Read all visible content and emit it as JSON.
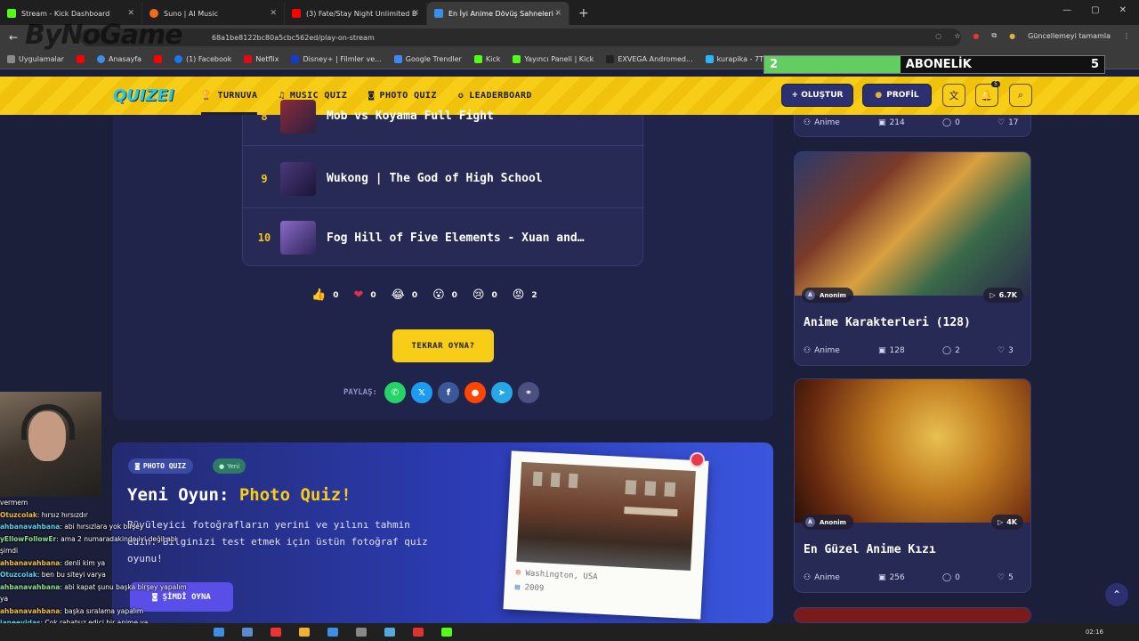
{
  "browser": {
    "tabs": [
      {
        "title": "Stream - Kick Dashboard",
        "color": "#53fc18"
      },
      {
        "title": "Suno | AI Music",
        "color": "#f26a1b"
      },
      {
        "title": "(3) Fate/Stay Night Unlimited B",
        "color": "#ff0000"
      },
      {
        "title": "En İyi Anime Dövüş Sahneleri -",
        "color": "#3c8ee7"
      }
    ],
    "url": "68a1be8122bc80a5cbc562ed/play-on-stream",
    "update_label": "Güncellemeyi tamamla",
    "bookmarks": [
      "Uygulamalar",
      "Anasayfa",
      "(1) Facebook",
      "Netflix",
      "Disney+ | Filmler ve...",
      "Google Trendler",
      "Kick",
      "Yayıncı Paneli | Kick",
      "EXVEGA Andromed...",
      "kurapika - 7TV",
      "Su"
    ],
    "other_bookmarks": "Tüm Yer İşaretleri"
  },
  "overlay": {
    "logo_text": "ByNoGame",
    "sub_current": "2",
    "sub_label": "ABONELİK",
    "sub_goal": "5",
    "sub_progress": 0.4
  },
  "site": {
    "brand": "QUIZEI",
    "nav": [
      "TURNUVA",
      "MUSIC QUIZ",
      "PHOTO QUIZ",
      "LEADERBOARD"
    ],
    "create_label": "+ OLUŞTUR",
    "profile_label": "PROFİL",
    "notif_count": "5"
  },
  "results": [
    {
      "rank": "8",
      "title": "Mob vs Koyama Full Fight"
    },
    {
      "rank": "9",
      "title": "Wukong | The God of High School"
    },
    {
      "rank": "10",
      "title": "Fog Hill of Five Elements - Xuan and…"
    }
  ],
  "reactions": [
    {
      "icon": "👍",
      "count": "0"
    },
    {
      "icon": "❤",
      "count": "0"
    },
    {
      "icon": "😂",
      "count": "0"
    },
    {
      "icon": "😮",
      "count": "0"
    },
    {
      "icon": "😢",
      "count": "0"
    },
    {
      "icon": "😡",
      "count": "2"
    }
  ],
  "play_again": "TEKRAR OYNA?",
  "share_label": "PAYLAŞ:",
  "promo": {
    "badge": "PHOTO QUIZ",
    "new_badge": "Yeni",
    "title_prefix": "Yeni Oyun: ",
    "title_highlight": "Photo Quiz!",
    "description": "Büyüleyici fotoğrafların yerini ve yılını tahmin edin. Bilginizi test etmek için üstün fotoğraf quiz oyunu!",
    "cta": "ŞİMDİ OYNA",
    "location": "Washington, USA",
    "year": "2009"
  },
  "sidebar": {
    "top_meta": {
      "category": "Anime",
      "questions": "214",
      "comments": "0",
      "likes": "17"
    },
    "cards": [
      {
        "author": "Anonim",
        "plays": "6.7K",
        "title": "Anime Karakterleri (128)",
        "category": "Anime",
        "questions": "128",
        "comments": "2",
        "likes": "3"
      },
      {
        "author": "Anonim",
        "plays": "4K",
        "title": "En Güzel Anime Kızı",
        "category": "Anime",
        "questions": "256",
        "comments": "0",
        "likes": "5"
      }
    ]
  },
  "chat": [
    {
      "user": "",
      "msg": "vermem"
    },
    {
      "user": "Otuzcolak",
      "msg": ": hırsız hırsızdır"
    },
    {
      "user": "ahbanavahbana",
      "msg": ": abi hırsızlara yok birşey"
    },
    {
      "user": "yEllowFollowEr",
      "msg": ": ama 2 numaradakinde iyi değil abi şimdi"
    },
    {
      "user": "ahbanavahbana",
      "msg": ": denli kim ya"
    },
    {
      "user": "Otuzcolak",
      "msg": ": ben bu siteyi varya"
    },
    {
      "user": "ahbanavahbana",
      "msg": ": abi kapat şunu başka birşey yapalım ya"
    },
    {
      "user": "ahbanavahbana",
      "msg": ": başka sıralama yapalım"
    },
    {
      "user": "janeevidas",
      "msg": ": Çok rahatsız edici bir anime ya"
    },
    {
      "user": "Drazzak",
      "msg": ": buda olmadı gibi"
    },
    {
      "user": "ahbanavahbana",
      "msg": ": zaten olmask"
    }
  ],
  "taskbar": {
    "time": "02:16"
  }
}
